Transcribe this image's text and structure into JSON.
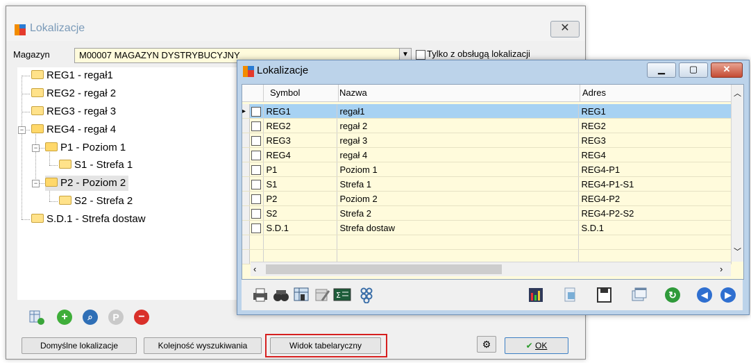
{
  "back_window": {
    "title": "Lokalizacje",
    "close_glyph": "✕",
    "magazyn_label": "Magazyn",
    "magazyn_value": "M00007 MAGAZYN DYSTRYBUCYJNY",
    "only_with_locations_label": "Tylko z obsługą lokalizacji",
    "tree": [
      {
        "label": "REG1 - regał1"
      },
      {
        "label": "REG2 - regał 2"
      },
      {
        "label": "REG3 - regał 3"
      },
      {
        "label": "REG4 - regał 4"
      },
      {
        "label": "P1 - Poziom 1"
      },
      {
        "label": "S1 - Strefa 1"
      },
      {
        "label": "P2 - Poziom 2"
      },
      {
        "label": "S2 - Strefa 2"
      },
      {
        "label": "S.D.1 - Strefa dostaw"
      }
    ],
    "buttons": {
      "default_locations": "Domyślne lokalizacje",
      "search_order": "Kolejność wyszukiwania",
      "table_view": "Widok tabelaryczny",
      "ok": "OK"
    },
    "bottom_icons": [
      "grid-add-icon",
      "add-icon",
      "search-icon",
      "p-icon",
      "delete-icon"
    ]
  },
  "front_window": {
    "title": "Lokalizacje",
    "columns": [
      "Symbol",
      "Nazwa",
      "Adres"
    ],
    "rows": [
      {
        "symbol": "REG1",
        "nazwa": "regał1",
        "adres": "REG1"
      },
      {
        "symbol": "REG2",
        "nazwa": "regał 2",
        "adres": "REG2"
      },
      {
        "symbol": "REG3",
        "nazwa": "regał 3",
        "adres": "REG3"
      },
      {
        "symbol": "REG4",
        "nazwa": "regał 4",
        "adres": "REG4"
      },
      {
        "symbol": "P1",
        "nazwa": "Poziom 1",
        "adres": "REG4-P1"
      },
      {
        "symbol": "S1",
        "nazwa": "Strefa 1",
        "adres": "REG4-P1-S1"
      },
      {
        "symbol": "P2",
        "nazwa": "Poziom 2",
        "adres": "REG4-P2"
      },
      {
        "symbol": "S2",
        "nazwa": "Strefa 2",
        "adres": "REG4-P2-S2"
      },
      {
        "symbol": "S.D.1",
        "nazwa": "Strefa dostaw",
        "adres": "S.D.1"
      }
    ],
    "selected_row": 0,
    "toolbar_icons": [
      "print-icon",
      "binoculars-icon",
      "filter-icon",
      "column-chooser-icon",
      "sum-icon",
      "link-icon",
      "chart-icon",
      "export-icon",
      "save-icon",
      "windows-icon",
      "refresh-icon",
      "prev-icon",
      "next-icon"
    ]
  },
  "colors": {
    "grid_background": "#fffbdc",
    "selection": "#a7d2f3",
    "highlight_border": "#d62020",
    "window_frame": "#bcd3ea"
  }
}
